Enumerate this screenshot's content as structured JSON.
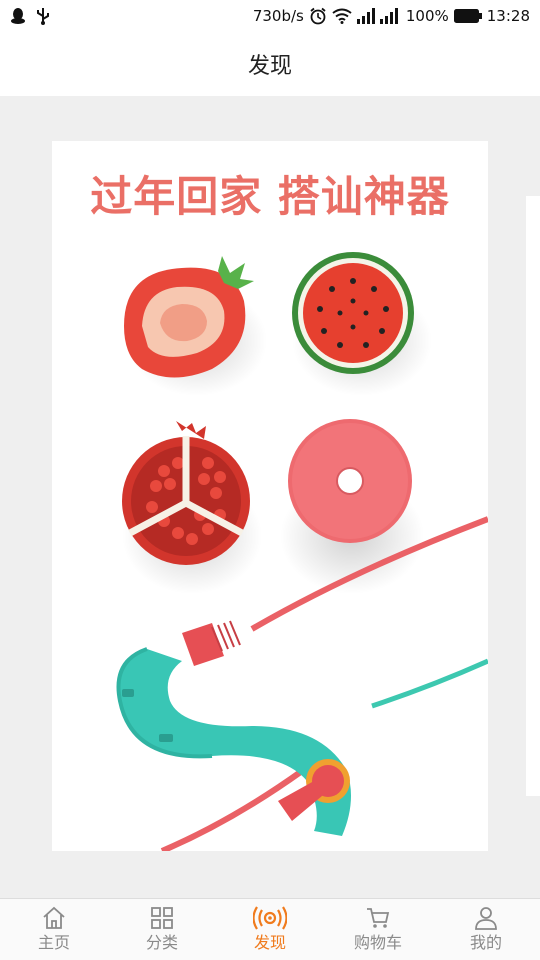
{
  "status_bar": {
    "speed": "730b/s",
    "battery": "100%",
    "time": "13:28",
    "icons": [
      "qq-icon",
      "usb-icon",
      "alarm-icon",
      "wifi-icon",
      "signal-icon",
      "battery-icon"
    ]
  },
  "header": {
    "title": "发现"
  },
  "banner": {
    "headline": "过年回家 搭讪神器"
  },
  "bottom_nav": {
    "items": [
      {
        "label": "主页",
        "icon": "home-icon"
      },
      {
        "label": "分类",
        "icon": "grid-icon"
      },
      {
        "label": "发现",
        "icon": "discover-icon",
        "active": true
      },
      {
        "label": "购物车",
        "icon": "cart-icon"
      },
      {
        "label": "我的",
        "icon": "user-icon"
      }
    ],
    "active_color": "#f07b1d",
    "inactive_color": "#8a8a8a"
  },
  "colors": {
    "headline": "#ea6f66",
    "background": "#efefef"
  }
}
